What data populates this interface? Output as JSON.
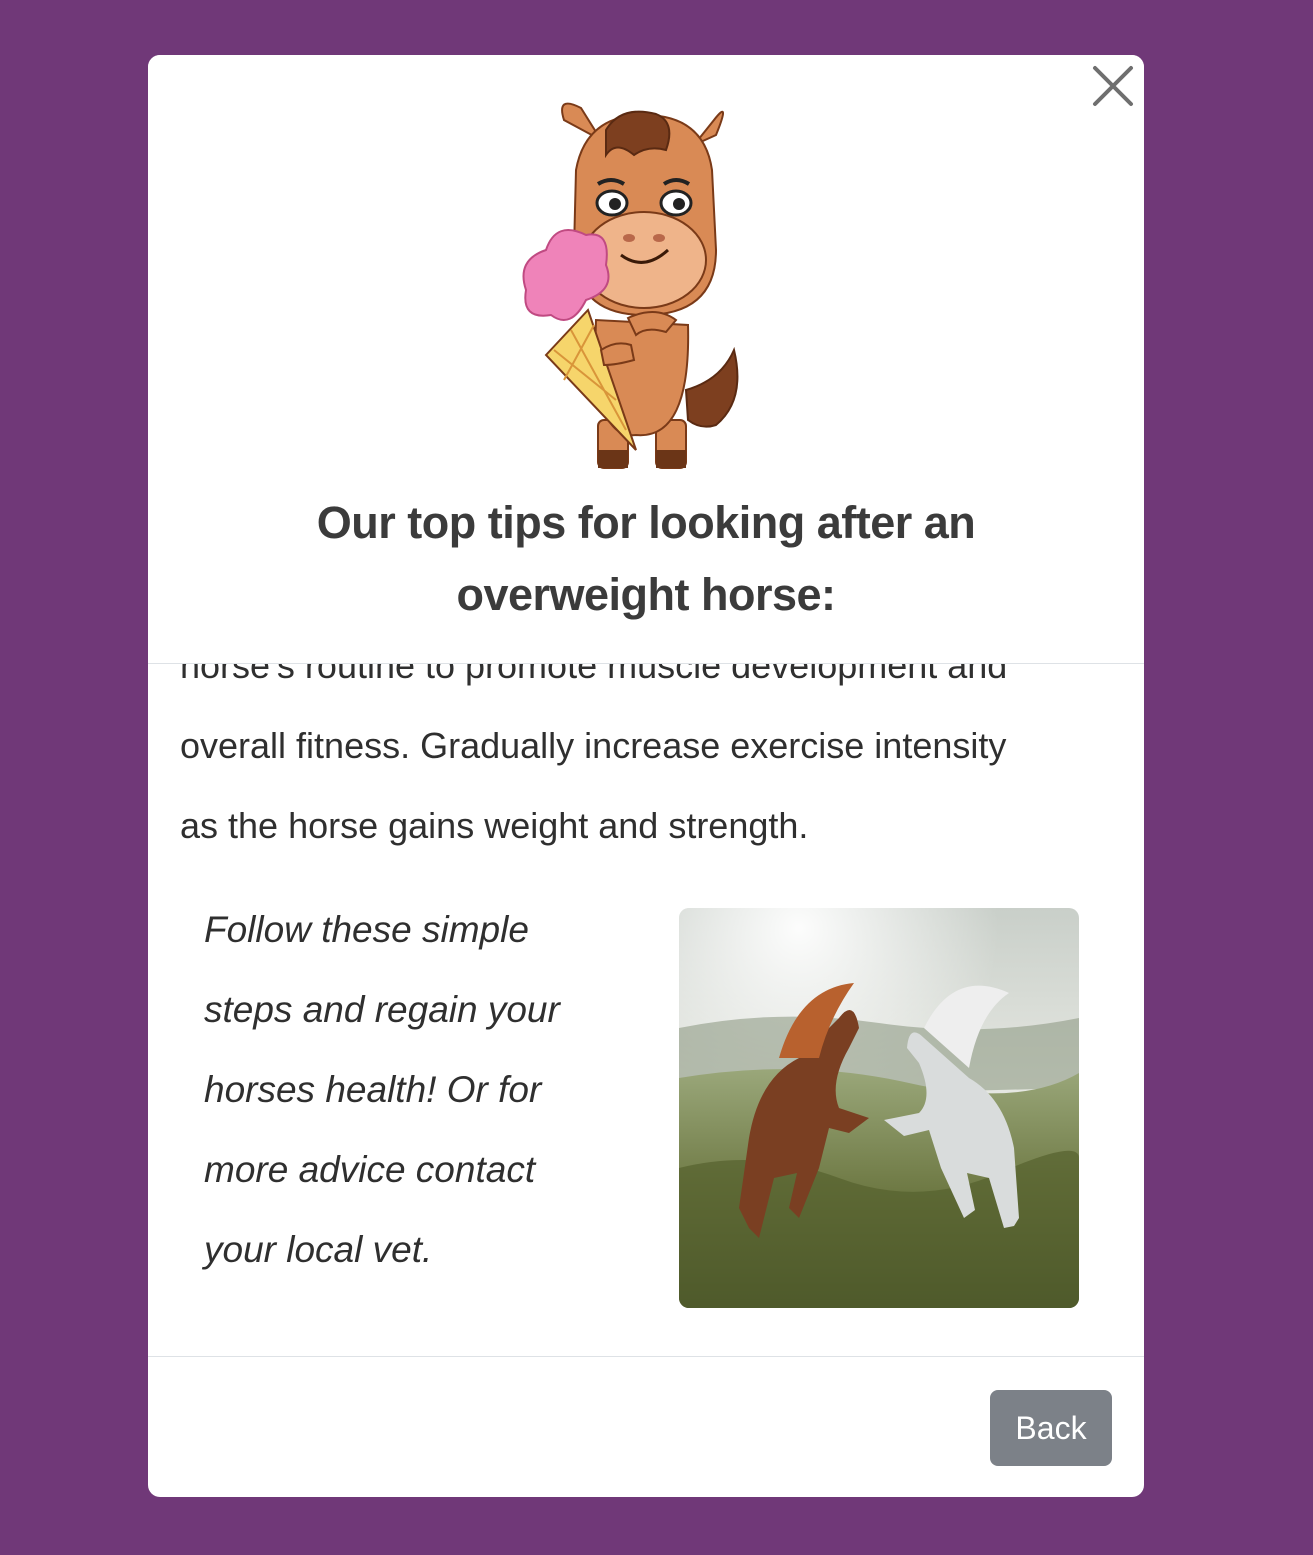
{
  "modal": {
    "title": "Our top tips for looking after an overweight horse:",
    "close_icon": "close-icon",
    "mascot_icon": "horse-mascot-with-ice-cream",
    "body": {
      "partial_line": "horse's routine to promote muscle development and",
      "tip_lines": [
        "overall fitness. Gradually increase exercise intensity",
        "as the horse gains weight and strength."
      ],
      "closing_lines": [
        "Follow these simple",
        "steps and regain your",
        "horses health! Or for",
        "more advice contact",
        "your local vet."
      ],
      "photo_icon": "two-horses-rearing-photo"
    },
    "footer": {
      "back_label": "Back"
    }
  },
  "colors": {
    "page_background": "#703878",
    "modal_background": "#ffffff",
    "title_text": "#3b3b3b",
    "back_button": "#7c8188"
  }
}
